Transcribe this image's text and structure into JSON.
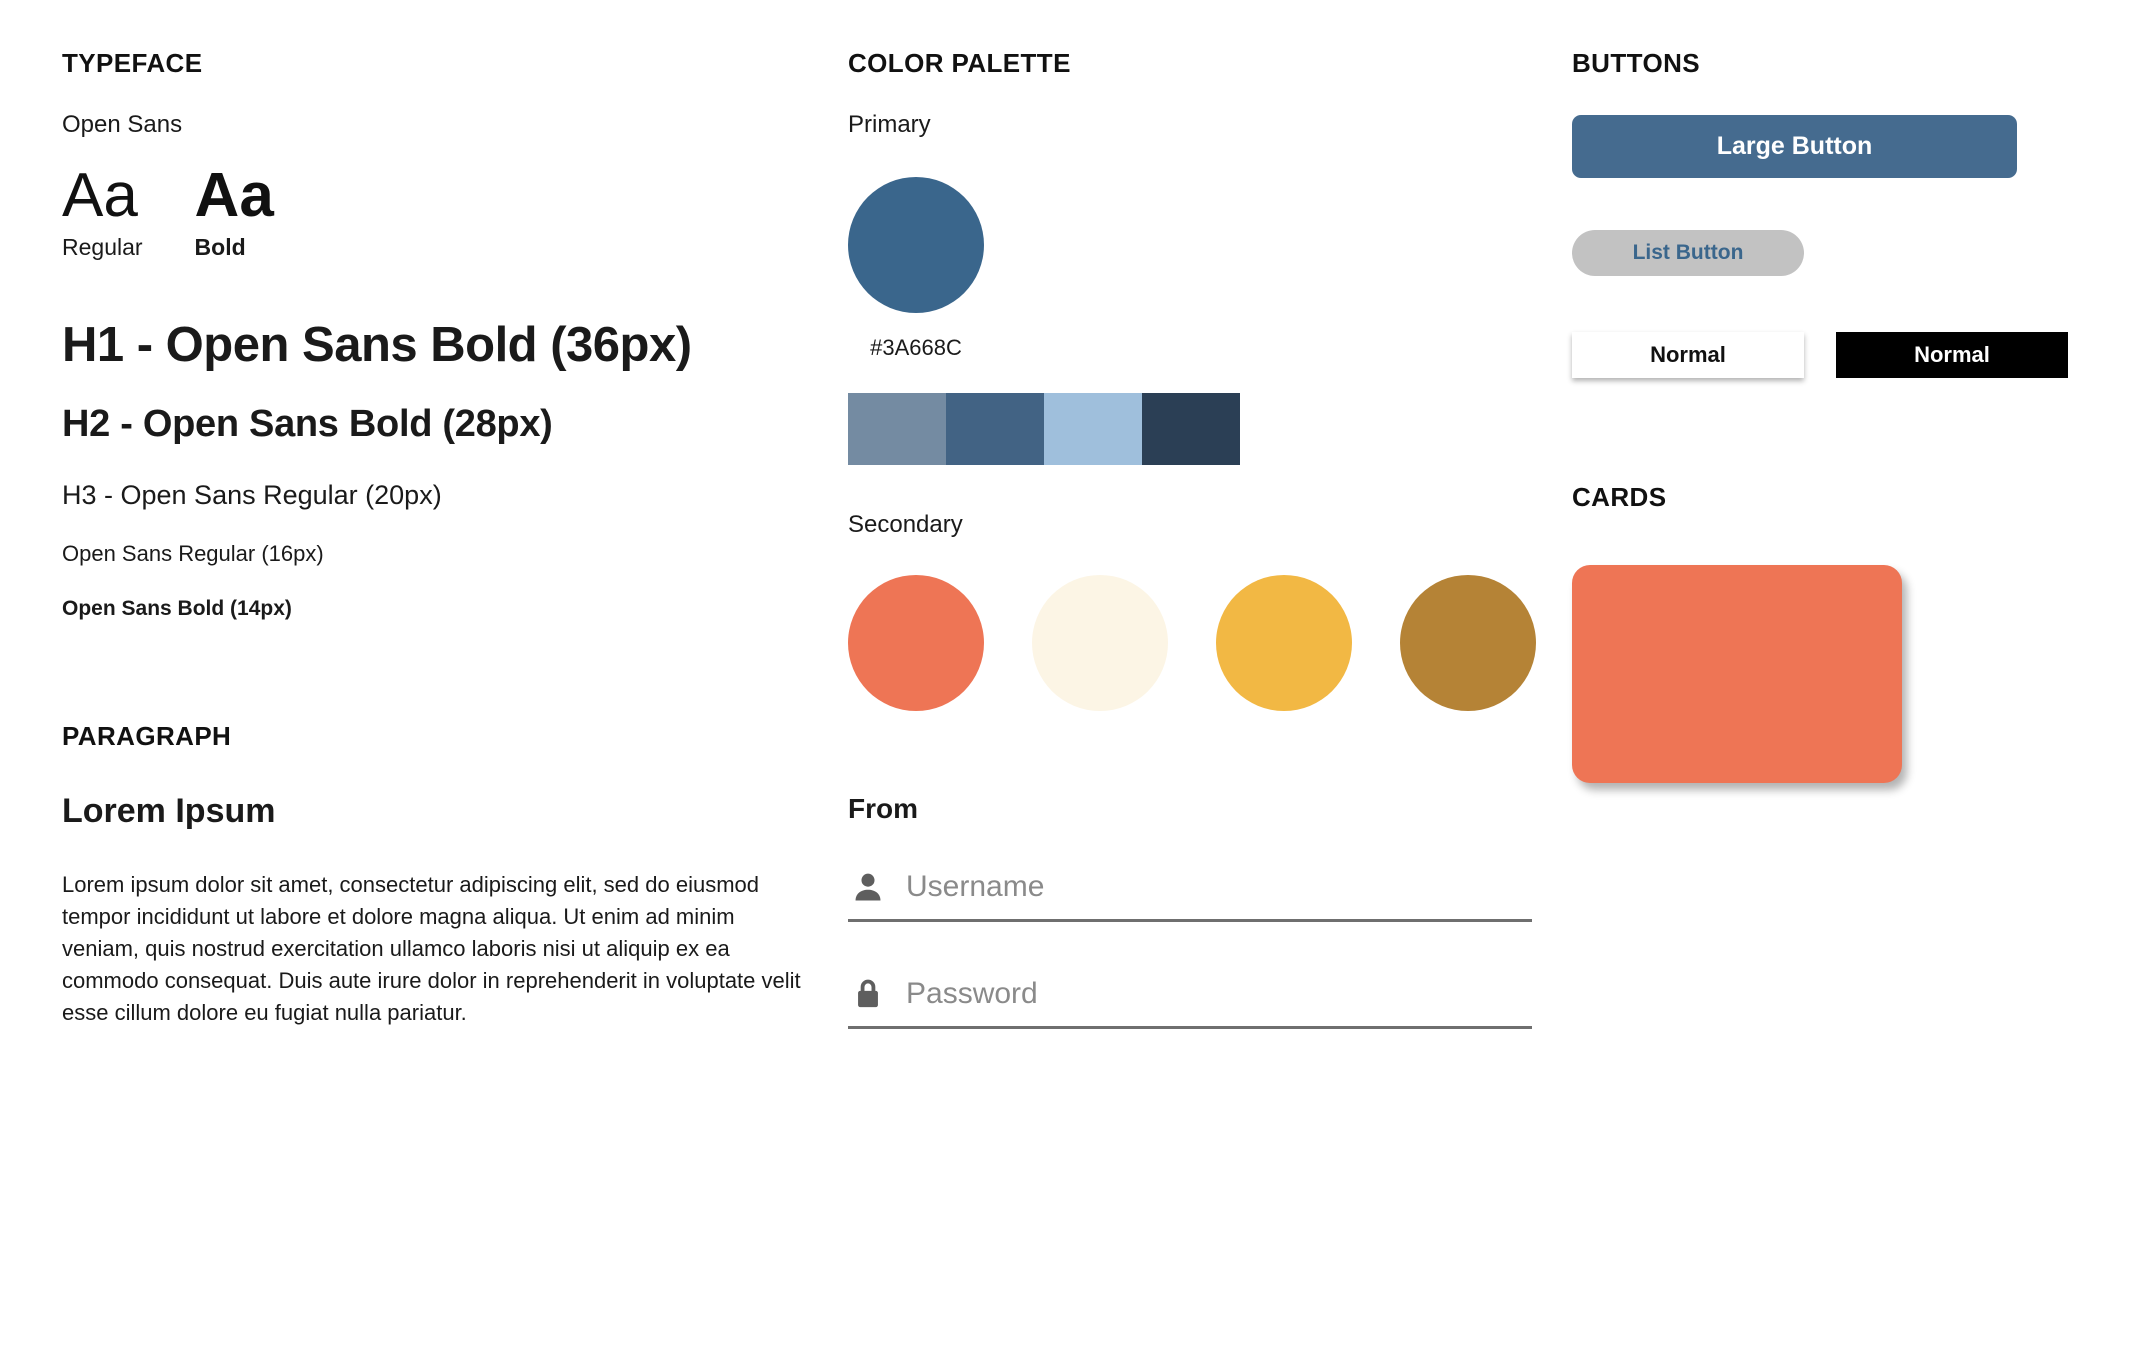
{
  "typeface": {
    "section_title": "TYPEFACE",
    "font_name": "Open Sans",
    "specimens": [
      {
        "glyph": "Aa",
        "label": "Regular"
      },
      {
        "glyph": "Aa",
        "label": "Bold"
      }
    ],
    "scale": [
      "H1 - Open Sans Bold (36px)",
      "H2 - Open Sans Bold (28px)",
      "H3 - Open Sans Regular (20px)",
      "Open Sans Regular (16px)",
      "Open Sans Bold (14px)"
    ]
  },
  "paragraph": {
    "section_title": "PARAGRAPH",
    "title": "Lorem Ipsum",
    "body": "Lorem ipsum dolor sit amet, consectetur adipiscing elit, sed do eiusmod tempor incididunt ut labore et dolore magna aliqua. Ut enim ad minim veniam, quis nostrud exercitation ullamco laboris nisi ut aliquip ex ea commodo consequat. Duis aute irure dolor in reprehenderit in voluptate velit esse cillum dolore eu fugiat nulla pariatur."
  },
  "color_palette": {
    "section_title": "COLOR PALETTE",
    "primary_label": "Primary",
    "primary_hex": "#3A668C",
    "primary_hex_label": "#3A668C",
    "tints": [
      {
        "name": "slate-blue",
        "hex": "#748BA2"
      },
      {
        "name": "medium-blue",
        "hex": "#426384"
      },
      {
        "name": "light-blue",
        "hex": "#9FBFDC"
      },
      {
        "name": "dark-navy",
        "hex": "#2B3F55"
      }
    ],
    "secondary_label": "Secondary",
    "secondary": [
      {
        "name": "coral",
        "hex": "#EE7555"
      },
      {
        "name": "cream",
        "hex": "#FCF5E5"
      },
      {
        "name": "amber",
        "hex": "#F2B844"
      },
      {
        "name": "bronze",
        "hex": "#B58336"
      }
    ]
  },
  "form": {
    "section_title": "From",
    "fields": [
      {
        "icon": "user-icon",
        "placeholder": "Username",
        "value": ""
      },
      {
        "icon": "lock-icon",
        "placeholder": "Password",
        "value": ""
      }
    ]
  },
  "buttons": {
    "section_title": "BUTTONS",
    "large": {
      "label": "Large Button",
      "bg": "#456B8F",
      "fg": "#FFFFFF"
    },
    "list": {
      "label": "List Button",
      "bg": "#C2C2C2",
      "fg": "#3A668C"
    },
    "normal_light": {
      "label": "Normal",
      "bg": "#FFFFFF",
      "fg": "#111111"
    },
    "normal_dark": {
      "label": "Normal",
      "bg": "#000000",
      "fg": "#FFFFFF"
    }
  },
  "cards": {
    "section_title": "CARDS",
    "card_color": "#EE7555"
  }
}
